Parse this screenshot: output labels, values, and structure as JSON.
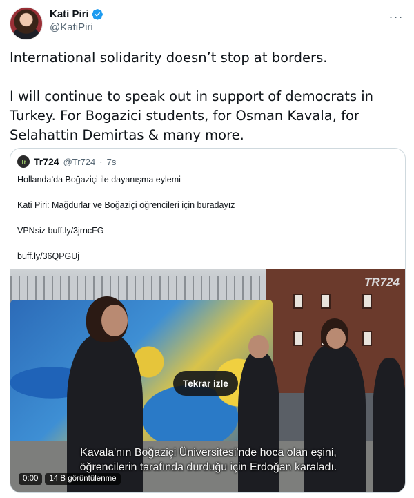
{
  "tweet": {
    "author_name": "Kati Piri",
    "author_handle": "@KatiPiri",
    "text_line1": "International solidarity doesn’t stop at borders.",
    "text_para2_line1": "I will continue to speak out in support of democrats in",
    "text_para2_line2": "Turkey. For Bogazici students, for Osman Kavala, for",
    "text_para2_line3": "Selahattin Demirtas & many more.",
    "more_label": "···"
  },
  "quoted": {
    "name": "Tr724",
    "handle": "@Tr724",
    "separator": "·",
    "time": "7s",
    "avatar_text": "Tr",
    "lines": [
      "Hollanda’da Boğaziçi ile dayanışma eylemi",
      "Kati Piri: Mağdurlar ve Boğaziçi öğrencileri için buradayız",
      "VPNsiz buff.ly/3jrncFG",
      "buff.ly/36QPGUj"
    ]
  },
  "video": {
    "logo": "TR724",
    "replay_label": "Tekrar izle",
    "subtitle_line1": "Kavala'nın Boğaziçi Üniversitesi'nde hoca olan eşini,",
    "subtitle_line2": "öğrencilerin tarafında durduğu için Erdoğan karaladı.",
    "timestamp": "0:00",
    "views": "14 B görüntülenme"
  },
  "colors": {
    "verified_blue": "#1d9bf0",
    "text_primary": "#0f1419",
    "text_secondary": "#536471",
    "border": "#cfd9de"
  }
}
